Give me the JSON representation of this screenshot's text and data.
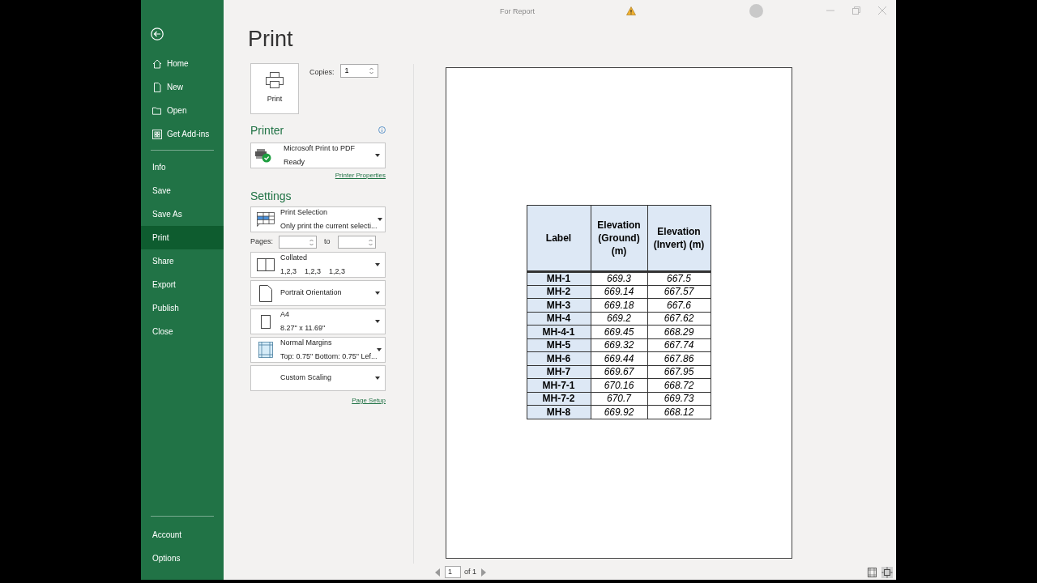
{
  "window": {
    "title": "For Report"
  },
  "sidebar": {
    "items": [
      {
        "label": "Home",
        "selected": false
      },
      {
        "label": "New",
        "selected": false
      },
      {
        "label": "Open",
        "selected": false
      },
      {
        "label": "Get Add-ins",
        "selected": false
      },
      {
        "label": "Info",
        "selected": false
      },
      {
        "label": "Save",
        "selected": false
      },
      {
        "label": "Save As",
        "selected": false
      },
      {
        "label": "Print",
        "selected": true
      },
      {
        "label": "Share",
        "selected": false
      },
      {
        "label": "Export",
        "selected": false
      },
      {
        "label": "Publish",
        "selected": false
      },
      {
        "label": "Close",
        "selected": false
      }
    ],
    "bottom_items": [
      {
        "label": "Account",
        "selected": false
      },
      {
        "label": "Options",
        "selected": false
      }
    ]
  },
  "print": {
    "title": "Print",
    "print_button": "Print",
    "copies_label": "Copies:",
    "copies_value": "1",
    "printer_heading": "Printer",
    "printer_name": "Microsoft Print to PDF",
    "printer_status": "Ready",
    "printer_properties": "Printer Properties",
    "settings_heading": "Settings",
    "settings": [
      {
        "kind": "dropdown",
        "title": "Print Selection",
        "subtitle": "Only print the current selecti..."
      },
      {
        "kind": "pages",
        "label": "Pages:",
        "to": "to"
      },
      {
        "kind": "dropdown",
        "title": "Collated",
        "subtitle": "1,2,3    1,2,3    1,2,3"
      },
      {
        "kind": "dropdown",
        "title": "Portrait Orientation"
      },
      {
        "kind": "dropdown",
        "title": "A4",
        "subtitle": "8.27\" x 11.69\""
      },
      {
        "kind": "dropdown",
        "title": "Normal Margins",
        "subtitle": "Top: 0.75\" Bottom: 0.75\" Lef..."
      },
      {
        "kind": "dropdown",
        "title": "Custom Scaling"
      }
    ],
    "page_setup": "Page Setup"
  },
  "preview": {
    "table": {
      "columns": [
        "Label",
        "Elevation (Ground) (m)",
        "Elevation (Invert) (m)"
      ],
      "rows": [
        [
          "MH-1",
          "669.3",
          "667.5"
        ],
        [
          "MH-2",
          "669.14",
          "667.57"
        ],
        [
          "MH-3",
          "669.18",
          "667.6"
        ],
        [
          "MH-4",
          "669.2",
          "667.62"
        ],
        [
          "MH-4-1",
          "669.45",
          "668.29"
        ],
        [
          "MH-5",
          "669.32",
          "667.74"
        ],
        [
          "MH-6",
          "669.44",
          "667.86"
        ],
        [
          "MH-7",
          "669.67",
          "667.95"
        ],
        [
          "MH-7-1",
          "670.16",
          "668.72"
        ],
        [
          "MH-7-2",
          "670.7",
          "669.73"
        ],
        [
          "MH-8",
          "669.92",
          "668.12"
        ]
      ]
    },
    "page_value": "1",
    "page_of": "of 1"
  }
}
